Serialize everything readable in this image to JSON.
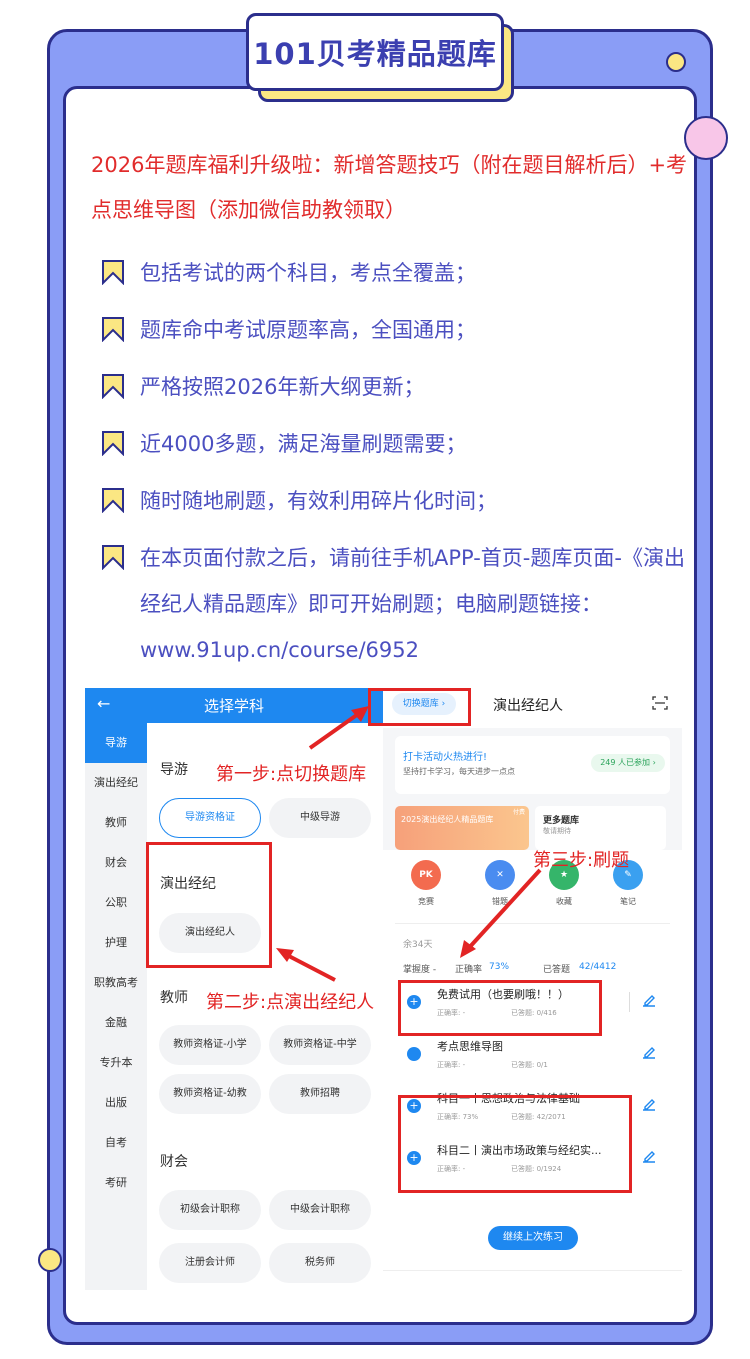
{
  "title": "101贝考精品题库",
  "headline": "2026年题库福利升级啦：新增答题技巧（附在题目解析后）+考点思维导图（添加微信助教领取）",
  "bullets": [
    "包括考试的两个科目，考点全覆盖；",
    "题库命中考试原题率高，全国通用；",
    "严格按照2026年新大纲更新；",
    "近4000多题，满足海量刷题需要；",
    "随时随地刷题，有效利用碎片化时间；",
    "在本页面付款之后，请前往手机APP-首页-题库页面-《演出经纪人精品题库》即可开始刷题；电脑刷题链接：www.91up.cn/course/6952"
  ],
  "left_screen": {
    "back": "←",
    "title": "选择学科",
    "sidebar": [
      "导游",
      "演出经纪",
      "教师",
      "财会",
      "公职",
      "护理",
      "职教高考",
      "金融",
      "专升本",
      "出版",
      "自考",
      "考研"
    ],
    "sections": [
      {
        "name": "导游",
        "pills": [
          "导游资格证",
          "中级导游"
        ]
      },
      {
        "name": "演出经纪",
        "pills": [
          "演出经纪人"
        ]
      },
      {
        "name": "教师",
        "pills": [
          "教师资格证-小学",
          "教师资格证-中学",
          "教师资格证-幼教",
          "教师招聘"
        ]
      },
      {
        "name": "财会",
        "pills": [
          "初级会计职称",
          "中级会计职称",
          "注册会计师",
          "税务师"
        ]
      }
    ]
  },
  "right_screen": {
    "switch": "切换题库 ›",
    "title": "演出经纪人",
    "activity_title": "打卡活动火热进行!",
    "activity_sub": "坚持打卡学习，每天进步一点点",
    "activity_badge": "249 人已参加 ›",
    "banner1": "2025演出经纪人精品题库",
    "banner1_tag": "付费",
    "banner2_title": "更多题库",
    "banner2_sub": "敬请期待",
    "icons": [
      {
        "label": "竞赛",
        "glyph": "PK",
        "color": "#f36b4f"
      },
      {
        "label": "错题",
        "glyph": "✕",
        "color": "#4a8cf0"
      },
      {
        "label": "收藏",
        "glyph": "★",
        "color": "#35b56a"
      },
      {
        "label": "笔记",
        "glyph": "✎",
        "color": "#3aa0f0"
      }
    ],
    "days_left": "余34天",
    "mastery": "掌握度 -",
    "accuracy_label": "正确率",
    "accuracy": "73%",
    "answered_label": "已答题",
    "answered": "42/4412",
    "items": [
      {
        "name": "免费试用（也要刷哦！！）",
        "rate": "正确率: -",
        "done": "已答题: 0/416"
      },
      {
        "name": "考点思维导图",
        "rate": "正确率: -",
        "done": "已答题: 0/1"
      },
      {
        "name": "科目一丨思想政治与法律基础",
        "rate": "正确率: 73%",
        "done": "已答题: 42/2071"
      },
      {
        "name": "科目二丨演出市场政策与经纪实...",
        "rate": "正确率: -",
        "done": "已答题: 0/1924"
      }
    ],
    "continue": "继续上次练习"
  },
  "annotations": {
    "step1": "第一步:点切换题库",
    "step2": "第二步:点演出经纪人",
    "step3": "第三步:刷题"
  },
  "colors": {
    "frame": "#8a9df6",
    "accent": "#3b3fb0",
    "red": "#e22424",
    "app_blue": "#1e88f0"
  }
}
